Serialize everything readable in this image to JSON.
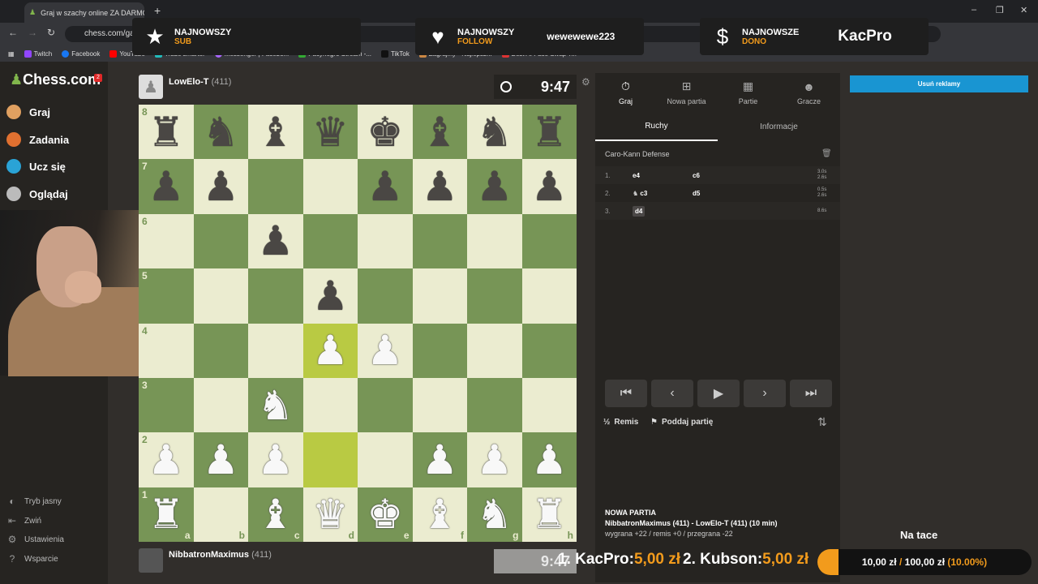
{
  "browser": {
    "tab_title": "Graj w szachy online ZA DARMO",
    "url": "chess.com/game",
    "bookmarks": [
      "Twitch",
      "Facebook",
      "YouTube",
      "Trade smarter",
      "Messenger | Facebo...",
      "Pacynegro Stream -...",
      "TikTok",
      "Zagrajmy - Najlepsz...",
      "Best AI Face Swap T..."
    ]
  },
  "overlays": {
    "sub": {
      "label": "NAJNOWSZY",
      "type": "SUB",
      "value": ""
    },
    "follow": {
      "label": "NAJNOWSZY",
      "type": "FOLLOW",
      "value": "wewewewe223"
    },
    "dono": {
      "label": "NAJNOWSZE",
      "type": "DONO",
      "value": "KacPro"
    }
  },
  "sidebar": {
    "logo_a": "Chess",
    "logo_b": ".com",
    "badge": "2",
    "items": [
      "Graj",
      "Zadania",
      "Ucz się",
      "Oglądaj"
    ],
    "bottom": [
      "Tryb jasny",
      "Zwiń",
      "Ustawienia",
      "Wsparcie"
    ]
  },
  "opponent": {
    "name": "LowElo-T",
    "rating": "(411)",
    "clock": "9:47"
  },
  "player": {
    "name": "NibbatronMaximus",
    "rating": "(411)",
    "clock": "9:47"
  },
  "board": {
    "ranks": [
      "8",
      "7",
      "6",
      "5",
      "4",
      "3",
      "2",
      "1"
    ],
    "files": [
      "a",
      "b",
      "c",
      "d",
      "e",
      "f",
      "g",
      "h"
    ],
    "rows": [
      [
        "br",
        "bn",
        "bb",
        "bq",
        "bk",
        "bb",
        "bn",
        "br"
      ],
      [
        "bp",
        "bp",
        "",
        "",
        "bp",
        "bp",
        "bp",
        "bp"
      ],
      [
        "",
        "",
        "bp",
        "",
        "",
        "",
        "",
        ""
      ],
      [
        "",
        "",
        "",
        "bp",
        "",
        "",
        "",
        ""
      ],
      [
        "",
        "",
        "",
        "wp",
        "wp",
        "",
        "",
        ""
      ],
      [
        "",
        "",
        "wn",
        "",
        "",
        "",
        "",
        ""
      ],
      [
        "wp",
        "wp",
        "wp",
        "",
        "",
        "wp",
        "wp",
        "wp"
      ],
      [
        "wr",
        "",
        "wb",
        "wq",
        "wk",
        "wb",
        "wn",
        "wr"
      ]
    ],
    "highlight": [
      "d4",
      "d2"
    ]
  },
  "panel": {
    "tabs": [
      "Graj",
      "Nowa partia",
      "Partie",
      "Gracze"
    ],
    "subtabs": [
      "Ruchy",
      "Informacje"
    ],
    "opening": "Caro-Kann Defense",
    "moves": [
      {
        "n": "1.",
        "w": "e4",
        "b": "c6",
        "tw": "3.0s",
        "tb": "2.6s"
      },
      {
        "n": "2.",
        "w": "c3",
        "b": "d5",
        "tw": "0.5s",
        "tb": "2.6s"
      },
      {
        "n": "3.",
        "w": "d4",
        "b": "",
        "tw": "8.6s",
        "tb": ""
      }
    ],
    "draw": "Remis",
    "resign": "Poddaj partię",
    "info_title": "NOWA PARTIA",
    "info_line": "NibbatronMaximus (411) - LowElo-T (411) (10 min)",
    "info_score": "wygrana +22 / remis +0 / przegrana -22"
  },
  "right": {
    "ad_button": "Usuń reklamy",
    "tray": "Na tace",
    "ticker1_name": "1. KacPro:",
    "ticker1_val": "5,00 zł",
    "ticker2_name": "2. Kubson:",
    "ticker2_val": "5,00 zł",
    "goal_current": "10,00 zł",
    "goal_sep": "/",
    "goal_total": "100,00 zł",
    "goal_pct": "(10.00%)",
    "goal_fraction": 0.1
  }
}
